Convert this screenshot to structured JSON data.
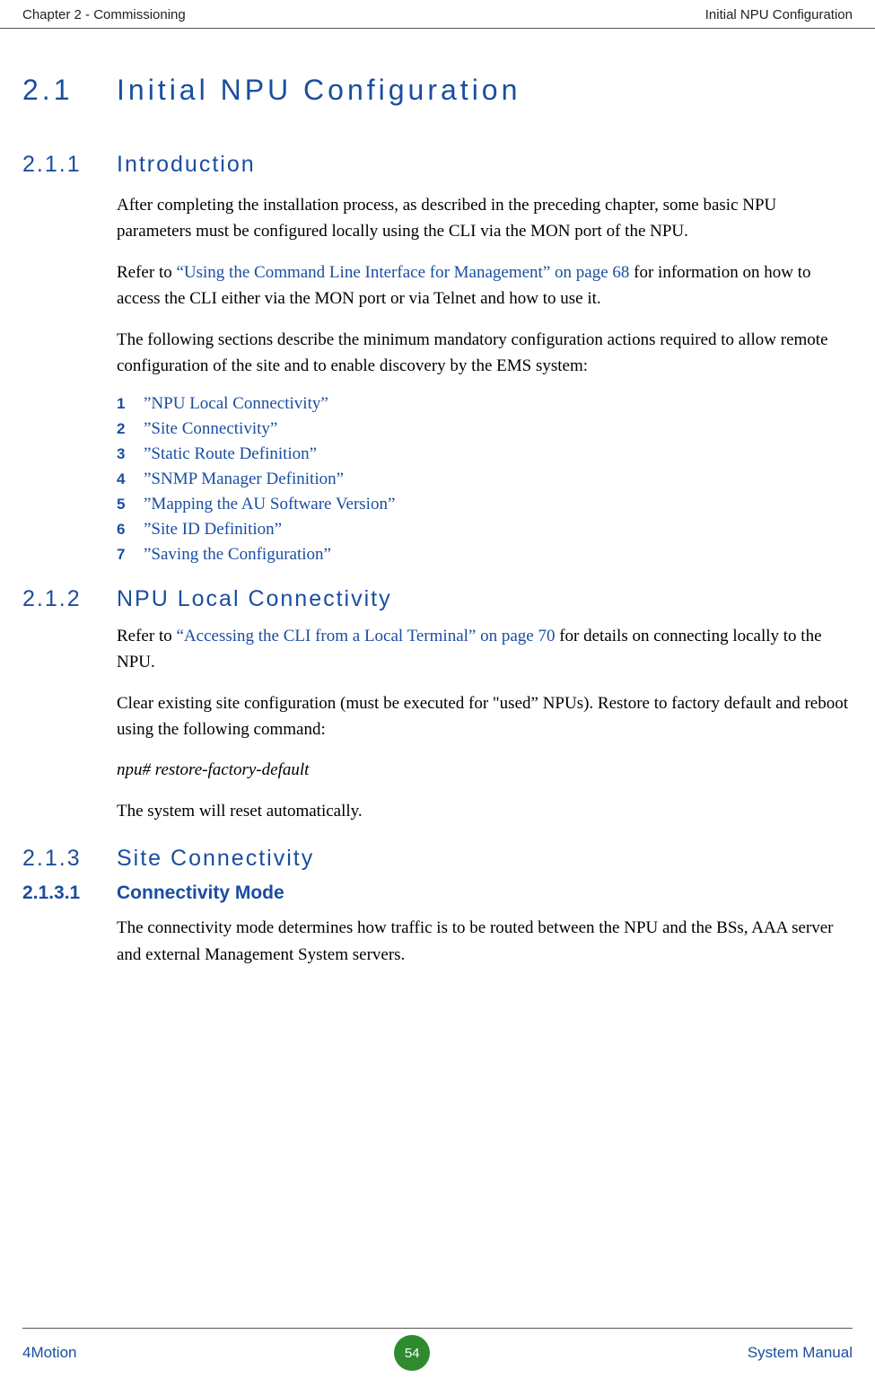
{
  "header": {
    "left": "Chapter 2 - Commissioning",
    "right": "Initial NPU Configuration"
  },
  "s1": {
    "num": "2.1",
    "title": "Initial NPU Configuration"
  },
  "s11": {
    "num": "2.1.1",
    "title": "Introduction",
    "p1": "After completing the installation process, as described in the preceding chapter, some basic NPU parameters must be configured locally using the CLI via the MON port of the NPU.",
    "p2a": "Refer to ",
    "p2link": "“Using the Command Line Interface for Management” on page 68",
    "p2b": " for information on how to access the CLI either via the MON port or via Telnet and how to use it.",
    "p3": "The following sections describe the minimum mandatory configuration actions required to allow remote configuration of the site and to enable discovery by the EMS system:",
    "list": {
      "n1": "1",
      "t1": "”NPU Local Connectivity”",
      "n2": "2",
      "t2": "”Site Connectivity”",
      "n3": "3",
      "t3": "”Static Route Definition”",
      "n4": "4",
      "t4": "”SNMP Manager Definition”",
      "n5": "5",
      "t5": "”Mapping the AU Software Version”",
      "n6": "6",
      "t6": "”Site ID Definition”",
      "n7": "7",
      "t7": "”Saving the Configuration”"
    }
  },
  "s12": {
    "num": "2.1.2",
    "title": "NPU Local Connectivity",
    "p1a": "Refer to ",
    "p1link": "“Accessing the CLI from a Local Terminal” on page 70",
    "p1b": " for details on connecting locally to the NPU.",
    "p2": "Clear existing site configuration (must be executed for \"used” NPUs). Restore to factory default and reboot using the following command:",
    "cmd": "npu# restore-factory-default",
    "p3": "The system will reset automatically."
  },
  "s13": {
    "num": "2.1.3",
    "title": "Site Connectivity"
  },
  "s131": {
    "num": "2.1.3.1",
    "title": "Connectivity Mode",
    "p1": "The connectivity mode determines how traffic is to be routed between the NPU and the BSs, AAA server and external Management System servers."
  },
  "footer": {
    "left": "4Motion",
    "page": "54",
    "right": "System Manual"
  }
}
